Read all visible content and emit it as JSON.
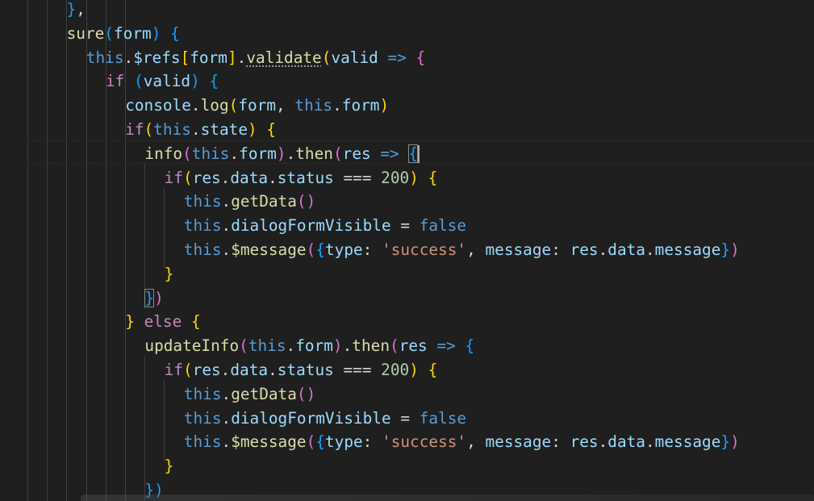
{
  "editor": {
    "lines": [
      {
        "indent": 3,
        "tokens": [
          {
            "t": "}",
            "c": "t-b3"
          },
          {
            "t": ",",
            "c": "t-punct"
          }
        ]
      },
      {
        "indent": 3,
        "tokens": [
          {
            "t": "sure",
            "c": "t-fn"
          },
          {
            "t": "(",
            "c": "t-b3"
          },
          {
            "t": "form",
            "c": "t-var"
          },
          {
            "t": ")",
            "c": "t-b3"
          },
          {
            "t": " ",
            "c": "t-punct"
          },
          {
            "t": "{",
            "c": "t-b3"
          }
        ]
      },
      {
        "indent": 4,
        "tokens": [
          {
            "t": "this",
            "c": "t-kw"
          },
          {
            "t": ".",
            "c": "t-punct"
          },
          {
            "t": "$refs",
            "c": "t-var"
          },
          {
            "t": "[",
            "c": "t-b1"
          },
          {
            "t": "form",
            "c": "t-var"
          },
          {
            "t": "]",
            "c": "t-b1"
          },
          {
            "t": ".",
            "c": "t-punct"
          },
          {
            "t": "validate",
            "c": "t-fn squiggle"
          },
          {
            "t": "(",
            "c": "t-b1"
          },
          {
            "t": "valid",
            "c": "t-var"
          },
          {
            "t": " ",
            "c": "t-punct"
          },
          {
            "t": "=>",
            "c": "t-kw"
          },
          {
            "t": " ",
            "c": "t-punct"
          },
          {
            "t": "{",
            "c": "t-b2"
          }
        ]
      },
      {
        "indent": 5,
        "tokens": [
          {
            "t": "if",
            "c": "t-ctl"
          },
          {
            "t": " ",
            "c": "t-punct"
          },
          {
            "t": "(",
            "c": "t-b3"
          },
          {
            "t": "valid",
            "c": "t-var"
          },
          {
            "t": ")",
            "c": "t-b3"
          },
          {
            "t": " ",
            "c": "t-punct"
          },
          {
            "t": "{",
            "c": "t-b3"
          }
        ]
      },
      {
        "indent": 6,
        "tokens": [
          {
            "t": "console",
            "c": "t-var"
          },
          {
            "t": ".",
            "c": "t-punct"
          },
          {
            "t": "log",
            "c": "t-fn"
          },
          {
            "t": "(",
            "c": "t-b1"
          },
          {
            "t": "form",
            "c": "t-var"
          },
          {
            "t": ", ",
            "c": "t-punct"
          },
          {
            "t": "this",
            "c": "t-kw"
          },
          {
            "t": ".",
            "c": "t-punct"
          },
          {
            "t": "form",
            "c": "t-var"
          },
          {
            "t": ")",
            "c": "t-b1"
          }
        ]
      },
      {
        "indent": 6,
        "tokens": [
          {
            "t": "if",
            "c": "t-ctl"
          },
          {
            "t": "(",
            "c": "t-b1"
          },
          {
            "t": "this",
            "c": "t-kw"
          },
          {
            "t": ".",
            "c": "t-punct"
          },
          {
            "t": "state",
            "c": "t-var"
          },
          {
            "t": ")",
            "c": "t-b1"
          },
          {
            "t": " ",
            "c": "t-punct"
          },
          {
            "t": "{",
            "c": "t-b1"
          }
        ]
      },
      {
        "indent": 7,
        "tokens": [
          {
            "t": "info",
            "c": "t-fn"
          },
          {
            "t": "(",
            "c": "t-b2"
          },
          {
            "t": "this",
            "c": "t-kw"
          },
          {
            "t": ".",
            "c": "t-punct"
          },
          {
            "t": "form",
            "c": "t-var"
          },
          {
            "t": ")",
            "c": "t-b2"
          },
          {
            "t": ".",
            "c": "t-punct"
          },
          {
            "t": "then",
            "c": "t-fn"
          },
          {
            "t": "(",
            "c": "t-b2"
          },
          {
            "t": "res",
            "c": "t-var"
          },
          {
            "t": " ",
            "c": "t-punct"
          },
          {
            "t": "=>",
            "c": "t-kw"
          },
          {
            "t": " ",
            "c": "t-punct"
          },
          {
            "t": "{",
            "c": "t-b3 match"
          }
        ]
      },
      {
        "indent": 8,
        "tokens": [
          {
            "t": "if",
            "c": "t-ctl"
          },
          {
            "t": "(",
            "c": "t-b1"
          },
          {
            "t": "res",
            "c": "t-var"
          },
          {
            "t": ".",
            "c": "t-punct"
          },
          {
            "t": "data",
            "c": "t-var"
          },
          {
            "t": ".",
            "c": "t-punct"
          },
          {
            "t": "status",
            "c": "t-var"
          },
          {
            "t": " === ",
            "c": "t-op"
          },
          {
            "t": "200",
            "c": "t-num"
          },
          {
            "t": ")",
            "c": "t-b1"
          },
          {
            "t": " ",
            "c": "t-punct"
          },
          {
            "t": "{",
            "c": "t-b1"
          }
        ]
      },
      {
        "indent": 9,
        "tokens": [
          {
            "t": "this",
            "c": "t-kw"
          },
          {
            "t": ".",
            "c": "t-punct"
          },
          {
            "t": "getData",
            "c": "t-fn"
          },
          {
            "t": "()",
            "c": "t-b2"
          }
        ]
      },
      {
        "indent": 9,
        "tokens": [
          {
            "t": "this",
            "c": "t-kw"
          },
          {
            "t": ".",
            "c": "t-punct"
          },
          {
            "t": "dialogFormVisible",
            "c": "t-var"
          },
          {
            "t": " = ",
            "c": "t-op"
          },
          {
            "t": "false",
            "c": "t-kw"
          }
        ]
      },
      {
        "indent": 9,
        "tokens": [
          {
            "t": "this",
            "c": "t-kw"
          },
          {
            "t": ".",
            "c": "t-punct"
          },
          {
            "t": "$message",
            "c": "t-fn"
          },
          {
            "t": "(",
            "c": "t-b2"
          },
          {
            "t": "{",
            "c": "t-b3"
          },
          {
            "t": "type",
            "c": "t-var"
          },
          {
            "t": ": ",
            "c": "t-punct"
          },
          {
            "t": "'success'",
            "c": "t-str"
          },
          {
            "t": ", ",
            "c": "t-punct"
          },
          {
            "t": "message",
            "c": "t-var"
          },
          {
            "t": ": ",
            "c": "t-punct"
          },
          {
            "t": "res",
            "c": "t-var"
          },
          {
            "t": ".",
            "c": "t-punct"
          },
          {
            "t": "data",
            "c": "t-var"
          },
          {
            "t": ".",
            "c": "t-punct"
          },
          {
            "t": "message",
            "c": "t-var"
          },
          {
            "t": "}",
            "c": "t-b3"
          },
          {
            "t": ")",
            "c": "t-b2"
          }
        ]
      },
      {
        "indent": 8,
        "tokens": [
          {
            "t": "}",
            "c": "t-b1"
          }
        ]
      },
      {
        "indent": 7,
        "tokens": [
          {
            "t": "}",
            "c": "t-b3 match"
          },
          {
            "t": ")",
            "c": "t-b2"
          }
        ]
      },
      {
        "indent": 6,
        "tokens": [
          {
            "t": "}",
            "c": "t-b1"
          },
          {
            "t": " ",
            "c": "t-punct"
          },
          {
            "t": "else",
            "c": "t-ctl"
          },
          {
            "t": " ",
            "c": "t-punct"
          },
          {
            "t": "{",
            "c": "t-b1"
          }
        ]
      },
      {
        "indent": 7,
        "tokens": [
          {
            "t": "updateInfo",
            "c": "t-fn"
          },
          {
            "t": "(",
            "c": "t-b2"
          },
          {
            "t": "this",
            "c": "t-kw"
          },
          {
            "t": ".",
            "c": "t-punct"
          },
          {
            "t": "form",
            "c": "t-var"
          },
          {
            "t": ")",
            "c": "t-b2"
          },
          {
            "t": ".",
            "c": "t-punct"
          },
          {
            "t": "then",
            "c": "t-fn"
          },
          {
            "t": "(",
            "c": "t-b2"
          },
          {
            "t": "res",
            "c": "t-var"
          },
          {
            "t": " ",
            "c": "t-punct"
          },
          {
            "t": "=>",
            "c": "t-kw"
          },
          {
            "t": " ",
            "c": "t-punct"
          },
          {
            "t": "{",
            "c": "t-b3"
          }
        ]
      },
      {
        "indent": 8,
        "tokens": [
          {
            "t": "if",
            "c": "t-ctl"
          },
          {
            "t": "(",
            "c": "t-b1"
          },
          {
            "t": "res",
            "c": "t-var"
          },
          {
            "t": ".",
            "c": "t-punct"
          },
          {
            "t": "data",
            "c": "t-var"
          },
          {
            "t": ".",
            "c": "t-punct"
          },
          {
            "t": "status",
            "c": "t-var"
          },
          {
            "t": " === ",
            "c": "t-op"
          },
          {
            "t": "200",
            "c": "t-num"
          },
          {
            "t": ")",
            "c": "t-b1"
          },
          {
            "t": " ",
            "c": "t-punct"
          },
          {
            "t": "{",
            "c": "t-b1"
          }
        ]
      },
      {
        "indent": 9,
        "tokens": [
          {
            "t": "this",
            "c": "t-kw"
          },
          {
            "t": ".",
            "c": "t-punct"
          },
          {
            "t": "getData",
            "c": "t-fn"
          },
          {
            "t": "()",
            "c": "t-b2"
          }
        ]
      },
      {
        "indent": 9,
        "tokens": [
          {
            "t": "this",
            "c": "t-kw"
          },
          {
            "t": ".",
            "c": "t-punct"
          },
          {
            "t": "dialogFormVisible",
            "c": "t-var"
          },
          {
            "t": " = ",
            "c": "t-op"
          },
          {
            "t": "false",
            "c": "t-kw"
          }
        ]
      },
      {
        "indent": 9,
        "tokens": [
          {
            "t": "this",
            "c": "t-kw"
          },
          {
            "t": ".",
            "c": "t-punct"
          },
          {
            "t": "$message",
            "c": "t-fn"
          },
          {
            "t": "(",
            "c": "t-b2"
          },
          {
            "t": "{",
            "c": "t-b3"
          },
          {
            "t": "type",
            "c": "t-var"
          },
          {
            "t": ": ",
            "c": "t-punct"
          },
          {
            "t": "'success'",
            "c": "t-str"
          },
          {
            "t": ", ",
            "c": "t-punct"
          },
          {
            "t": "message",
            "c": "t-var"
          },
          {
            "t": ": ",
            "c": "t-punct"
          },
          {
            "t": "res",
            "c": "t-var"
          },
          {
            "t": ".",
            "c": "t-punct"
          },
          {
            "t": "data",
            "c": "t-var"
          },
          {
            "t": ".",
            "c": "t-punct"
          },
          {
            "t": "message",
            "c": "t-var"
          },
          {
            "t": "}",
            "c": "t-b3"
          },
          {
            "t": ")",
            "c": "t-b2"
          }
        ]
      },
      {
        "indent": 8,
        "tokens": [
          {
            "t": "}",
            "c": "t-b1"
          }
        ]
      },
      {
        "indent": 7,
        "tokens": [
          {
            "t": "})",
            "c": "t-b3"
          }
        ]
      }
    ],
    "cursor_line": 6,
    "colors": {
      "background": "#1f1f1f",
      "keyword": "#569cd6",
      "control": "#c586c0",
      "function": "#dcdcaa",
      "variable": "#9cdcfe",
      "string": "#ce9178",
      "number": "#b5cea8",
      "bracket_gold": "#ffd700",
      "bracket_orchid": "#da70d6",
      "bracket_blue": "#179fff"
    }
  }
}
